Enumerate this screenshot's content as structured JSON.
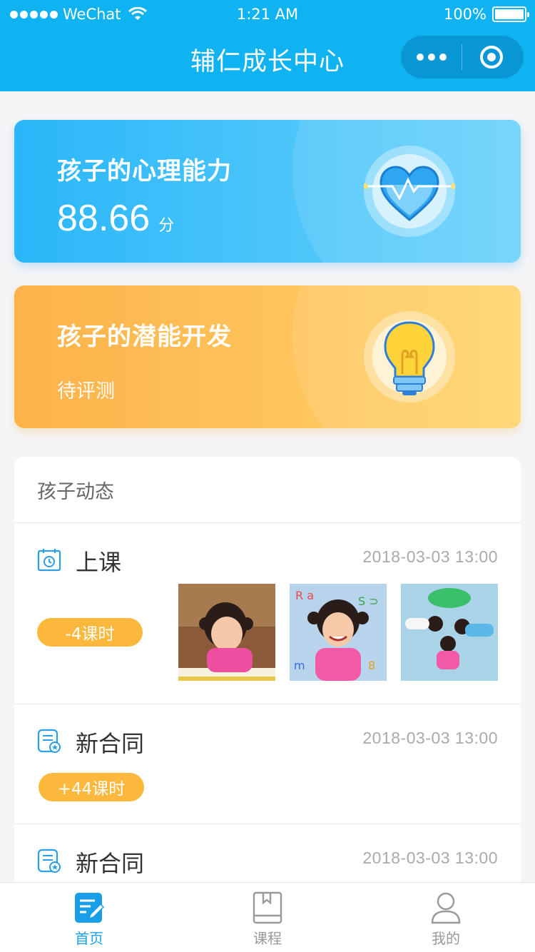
{
  "status_bar": {
    "carrier": "WeChat",
    "time": "1:21 AM",
    "battery": "100%",
    "battery_level": 1.0
  },
  "nav": {
    "title": "辅仁成长中心"
  },
  "cards": {
    "psych": {
      "title": "孩子的心理能力",
      "score": "88.66",
      "unit": "分",
      "icon": "heart-pulse-icon"
    },
    "potential": {
      "title": "孩子的潜能开发",
      "status": "待评测",
      "icon": "light-bulb-icon"
    }
  },
  "feed": {
    "header": "孩子动态",
    "items": [
      {
        "icon": "calendar-clock-icon",
        "title": "上课",
        "time": "2018-03-03   13:00",
        "badge": "-4课时"
      },
      {
        "icon": "contract-icon",
        "title": "新合同",
        "time": "2018-03-03   13:00",
        "badge": "+44课时"
      },
      {
        "icon": "contract-icon",
        "title": "新合同",
        "time": "2018-03-03   13:00"
      }
    ]
  },
  "tabbar": {
    "tabs": [
      {
        "label": "首页",
        "icon": "notebook-pen-icon",
        "active": true
      },
      {
        "label": "课程",
        "icon": "book-icon",
        "active": false
      },
      {
        "label": "我的",
        "icon": "user-icon",
        "active": false
      }
    ]
  },
  "colors": {
    "header": "#0fb3f2",
    "card_blue": "#2ab6f9",
    "card_orange": "#fdb24a",
    "pill": "#fcb83c",
    "tab_active": "#1a9ee8"
  }
}
